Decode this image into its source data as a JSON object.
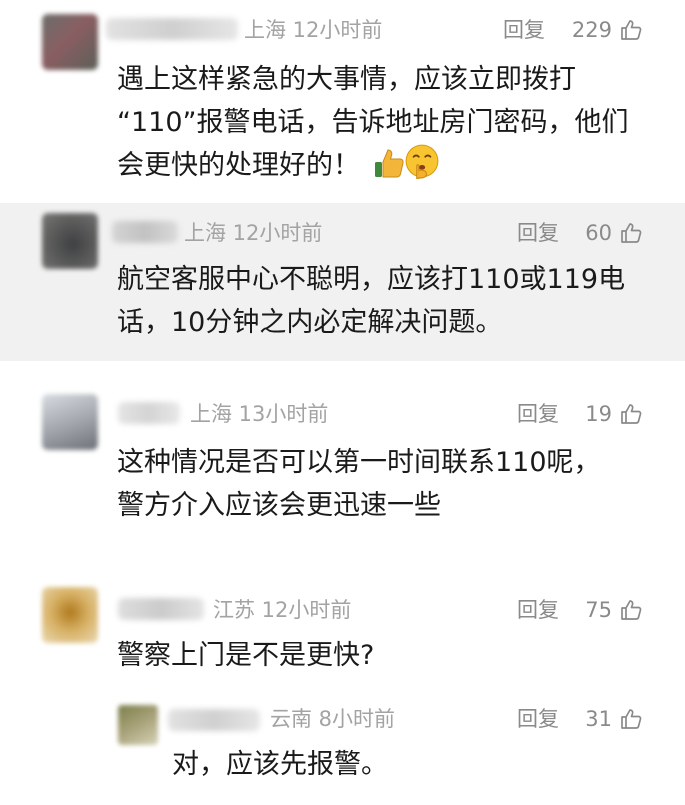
{
  "comments": [
    {
      "location_time": "上海 12小时前",
      "reply_label": "回复",
      "likes": "229",
      "lines": [
        "遇上这样紧急的大事情，应该立即拨打",
        "“110”报警电话，告诉地址房门密码，他们",
        "会更快的处理好的！"
      ],
      "emojis": [
        "thumbs-up-emoji",
        "shushing-face-emoji"
      ]
    },
    {
      "location_time": "上海 12小时前",
      "reply_label": "回复",
      "likes": "60",
      "lines": [
        "航空客服中心不聪明，应该打110或119电",
        "话，10分钟之内必定解决问题。"
      ]
    },
    {
      "location_time": "上海 13小时前",
      "reply_label": "回复",
      "likes": "19",
      "lines": [
        "这种情况是否可以第一时间联系110呢，",
        "警方介入应该会更迅速一些"
      ]
    },
    {
      "location_time": "江苏 12小时前",
      "reply_label": "回复",
      "likes": "75",
      "lines": [
        "警察上门是不是更快?"
      ]
    }
  ],
  "sub_reply": {
    "location_time": "云南 8小时前",
    "reply_label": "回复",
    "likes": "31",
    "text": "对，应该先报警。"
  },
  "colors": {
    "highlight_background": "#f1f1f1",
    "meta_text": "#a3a3a3",
    "body_text": "#1a1a1a"
  },
  "icons": [
    "like-thumb-icon"
  ]
}
